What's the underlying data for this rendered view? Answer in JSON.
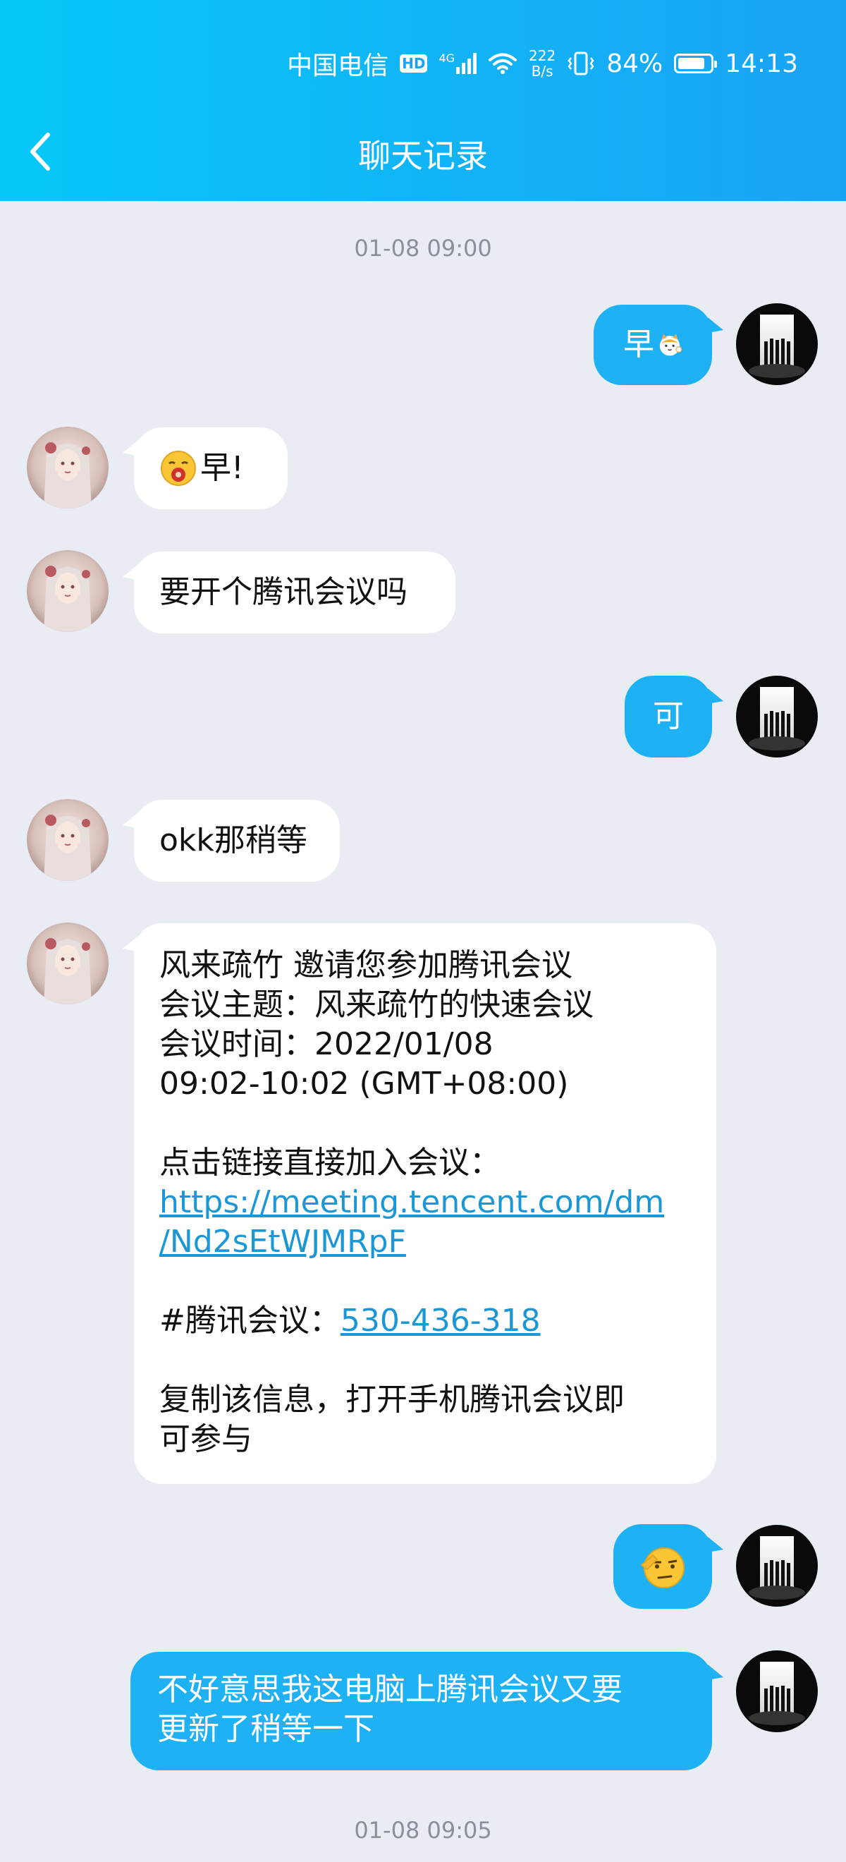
{
  "status_bar": {
    "carrier": "中国电信",
    "hd": "HD",
    "network": "4G",
    "speed_value": "222",
    "speed_unit": "B/s",
    "battery": "84%",
    "battery_level": 0.84,
    "time": "14:13"
  },
  "header": {
    "title": "聊天记录",
    "back_icon": "chevron-left-icon"
  },
  "colors": {
    "header_start": "#06c8f8",
    "header_end": "#1aa3f3",
    "background": "#e9ecf3",
    "sent_bubble": "#1eb2f5",
    "received_bubble": "#ffffff",
    "link": "#1b97d6"
  },
  "chat": {
    "timestamp_1": "01-08 09:00",
    "timestamp_2": "01-08 09:05",
    "msg1": {
      "text": "早",
      "emoji": "cat-waving-sticker"
    },
    "msg2": {
      "text": "早!",
      "emoji": "yawning-face-emoji"
    },
    "msg3": {
      "text": "要开个腾讯会议吗"
    },
    "msg4": {
      "text": "可"
    },
    "msg5": {
      "text": "okk那稍等"
    },
    "msg6": {
      "line1": "风来疏竹 邀请您参加腾讯会议",
      "line2": "会议主题：风来疏竹的快速会议",
      "line3": "会议时间：2022/01/08",
      "line4": "09:02-10:02 (GMT+08:00)",
      "line5": "点击链接直接加入会议：",
      "link1": "https://meeting.tencent.com/dm",
      "link2": "/Nd2sEtWJMRpF",
      "meeting_label": "#腾讯会议：",
      "meeting_id": "530-436-318",
      "line6": "复制该信息，打开手机腾讯会议即",
      "line7": "可参与"
    },
    "msg7": {
      "emoji": "salute-emoji"
    },
    "msg8": {
      "line1": "不好意思我这电脑上腾讯会议又要",
      "line2": "更新了稍等一下"
    }
  }
}
